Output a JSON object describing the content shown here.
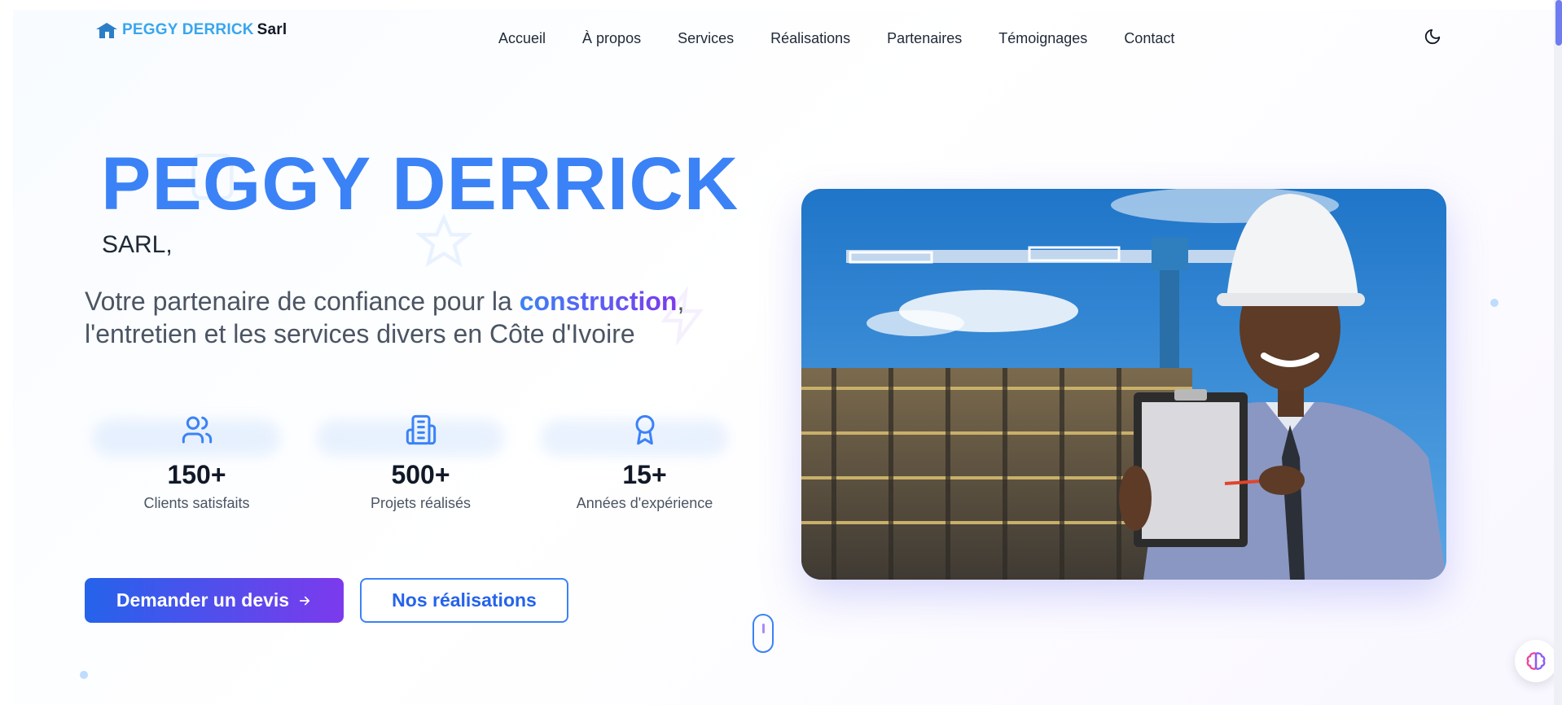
{
  "brand": {
    "name_main": "PEGGY DERRICK",
    "name_suffix": "Sarl",
    "colors": {
      "primary": "#3b82f6",
      "accent": "#7c3aed",
      "logo_blue": "#38a6ee"
    }
  },
  "nav": {
    "items": [
      {
        "label": "Accueil"
      },
      {
        "label": "À propos"
      },
      {
        "label": "Services"
      },
      {
        "label": "Réalisations"
      },
      {
        "label": "Partenaires"
      },
      {
        "label": "Témoignages"
      },
      {
        "label": "Contact"
      }
    ],
    "theme_toggle_icon": "moon-icon"
  },
  "hero": {
    "title": "PEGGY DERRICK",
    "subtitle": "SARL,",
    "description_before": "Votre partenaire de confiance pour la ",
    "description_highlight": "construction",
    "description_after": ", l'entretien et les services divers en Côte d'Ivoire",
    "stats": [
      {
        "icon": "users-icon",
        "value": "150+",
        "label": "Clients satisfaits"
      },
      {
        "icon": "building-icon",
        "value": "500+",
        "label": "Projets réalisés"
      },
      {
        "icon": "award-icon",
        "value": "15+",
        "label": "Années d'expérience"
      }
    ],
    "primary_button": "Demander un devis",
    "primary_button_icon": "arrow-right-icon",
    "secondary_button": "Nos réalisations",
    "image_icon": "construction-worker-photo"
  },
  "floating": {
    "assistant_icon": "brain-icon"
  }
}
